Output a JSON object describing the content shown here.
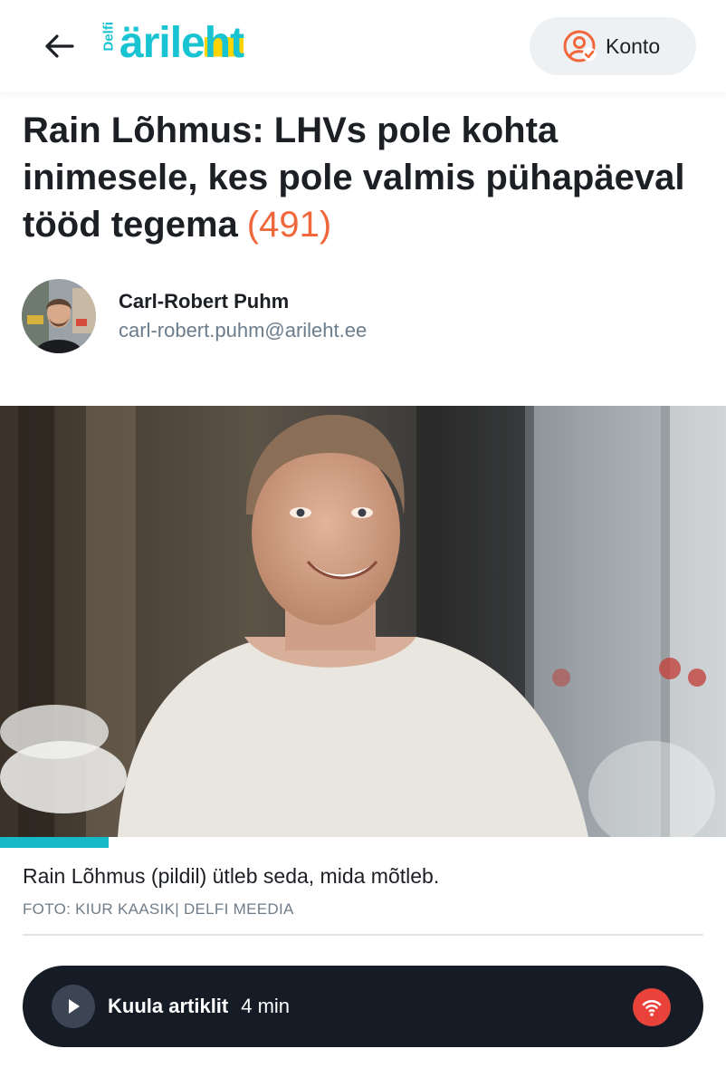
{
  "header": {
    "back_icon": "arrow-left-icon",
    "logo_small": "Delfi",
    "logo_main_start": "ärile",
    "logo_main_end": "ht",
    "account_label": "Konto",
    "account_icon": "user-check-icon",
    "brand_color": "#18c3d2"
  },
  "article": {
    "title": "Rain Lõhmus: LHVs pole kohta inimesele, kes pole valmis pühapäeval tööd tegema",
    "comment_count": "(491)",
    "accent_color": "#f1673c"
  },
  "author": {
    "name": "Carl-Robert Puhm",
    "email": "carl-robert.puhm@arileht.ee"
  },
  "image": {
    "caption": "Rain Lõhmus (pildil) ütleb seda, mida mõtleb.",
    "credit": "FOTO: KIUR KAASIK| DELFI MEEDIA",
    "gallery_progress": 0.15
  },
  "audio": {
    "label": "Kuula artiklit",
    "duration": "4 min",
    "play_icon": "play-icon",
    "brand_icon": "podcast-icon"
  }
}
